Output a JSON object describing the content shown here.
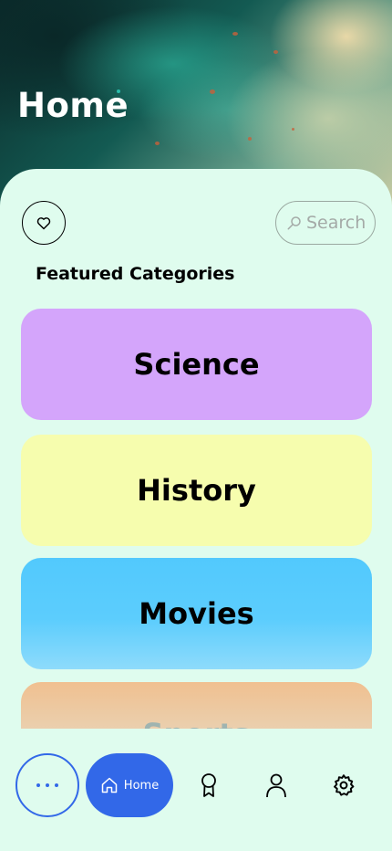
{
  "header": {
    "title": "Home"
  },
  "toolbar": {
    "favorite_icon": "heart-icon",
    "search_label": "Search",
    "search_icon": "search-icon"
  },
  "section": {
    "title": "Featured Categories"
  },
  "categories": [
    {
      "label": "Science",
      "color": "#d4a5fb"
    },
    {
      "label": "History",
      "color": "#f6fdae"
    },
    {
      "label": "Movies",
      "color": "#5ccdfd"
    },
    {
      "label": "Sports",
      "color": "#f1c394"
    }
  ],
  "bottom_nav": {
    "more_icon": "more-dots-icon",
    "home_label": "Home",
    "home_icon": "home-icon",
    "items": [
      "award-icon",
      "user-icon",
      "gear-icon"
    ]
  },
  "colors": {
    "accent": "#3268e8",
    "background": "#dffcee"
  }
}
